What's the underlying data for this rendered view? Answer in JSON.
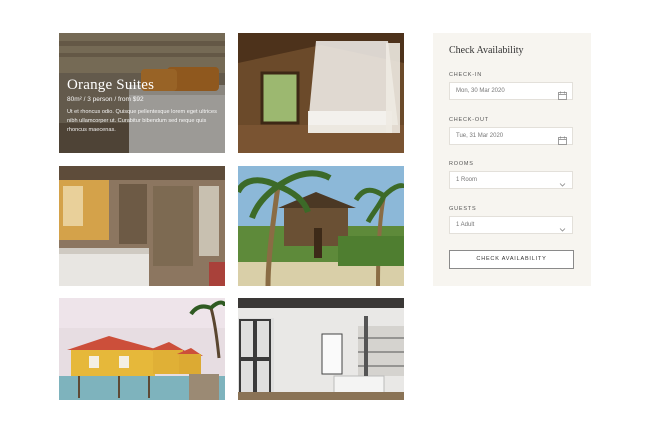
{
  "rooms": {
    "featured": {
      "title": "Orange Suites",
      "meta": "80m² / 3 person / from $92",
      "description": "Ut et rhoncus odio. Quisque pellentesque lorem eget ultrices nibh ullamcorper ut. Curabitur bibendum sed neque quis rhoncus maecenas."
    }
  },
  "availability": {
    "title": "Check Availability",
    "check_in": {
      "label": "CHECK-IN",
      "value": "Mon, 30 Mar 2020"
    },
    "check_out": {
      "label": "CHECK-OUT",
      "value": "Tue, 31 Mar 2020"
    },
    "rooms": {
      "label": "ROOMS",
      "value": "1 Room"
    },
    "guests": {
      "label": "GUESTS",
      "value": "1 Adult"
    },
    "button": "CHECK AVAILABILITY"
  },
  "icons": {
    "calendar": "calendar-icon",
    "dropdown": "chevron-down-icon"
  }
}
